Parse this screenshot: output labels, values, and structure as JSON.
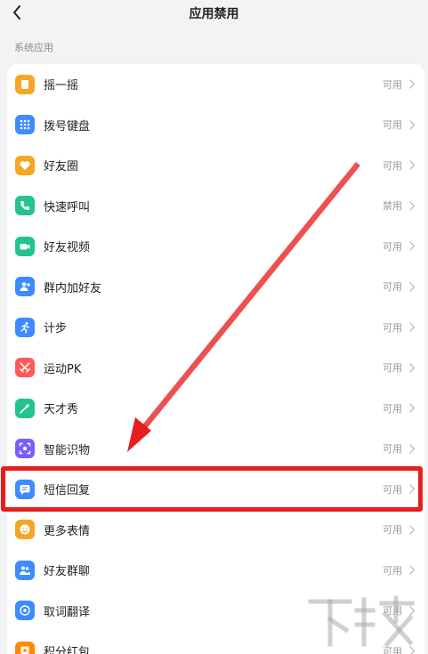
{
  "header": {
    "title": "应用禁用"
  },
  "section": {
    "label": "系统应用"
  },
  "apps": [
    {
      "name": "摇一摇",
      "status": "可用",
      "color": "#f5a623",
      "icon": "shake-icon"
    },
    {
      "name": "拨号键盘",
      "status": "可用",
      "color": "#3d8bff",
      "icon": "dialpad-icon"
    },
    {
      "name": "好友圈",
      "status": "可用",
      "color": "#f5a623",
      "icon": "heart-icon"
    },
    {
      "name": "快速呼叫",
      "status": "禁用",
      "color": "#22c38e",
      "icon": "phone-icon"
    },
    {
      "name": "好友视频",
      "status": "可用",
      "color": "#22c38e",
      "icon": "video-icon"
    },
    {
      "name": "群内加好友",
      "status": "可用",
      "color": "#3d8bff",
      "icon": "add-friend-icon"
    },
    {
      "name": "计步",
      "status": "可用",
      "color": "#3d8bff",
      "icon": "running-icon"
    },
    {
      "name": "运动PK",
      "status": "可用",
      "color": "#ff5a5a",
      "icon": "swords-icon"
    },
    {
      "name": "天才秀",
      "status": "可用",
      "color": "#22c38e",
      "icon": "magic-wand-icon"
    },
    {
      "name": "智能识物",
      "status": "可用",
      "color": "#7b5cff",
      "icon": "scan-icon"
    },
    {
      "name": "短信回复",
      "status": "可用",
      "color": "#3d8bff",
      "icon": "message-icon"
    },
    {
      "name": "更多表情",
      "status": "可用",
      "color": "#f5a623",
      "icon": "smile-icon"
    },
    {
      "name": "好友群聊",
      "status": "可用",
      "color": "#3d8bff",
      "icon": "group-icon"
    },
    {
      "name": "取词翻译",
      "status": "可用",
      "color": "#3d8bff",
      "icon": "translate-icon"
    },
    {
      "name": "积分红包",
      "status": "可用",
      "color": "#ff8a00",
      "icon": "red-packet-icon"
    }
  ],
  "colors": {
    "highlight": "#e61e1e",
    "arrow": "#e61e1e"
  }
}
